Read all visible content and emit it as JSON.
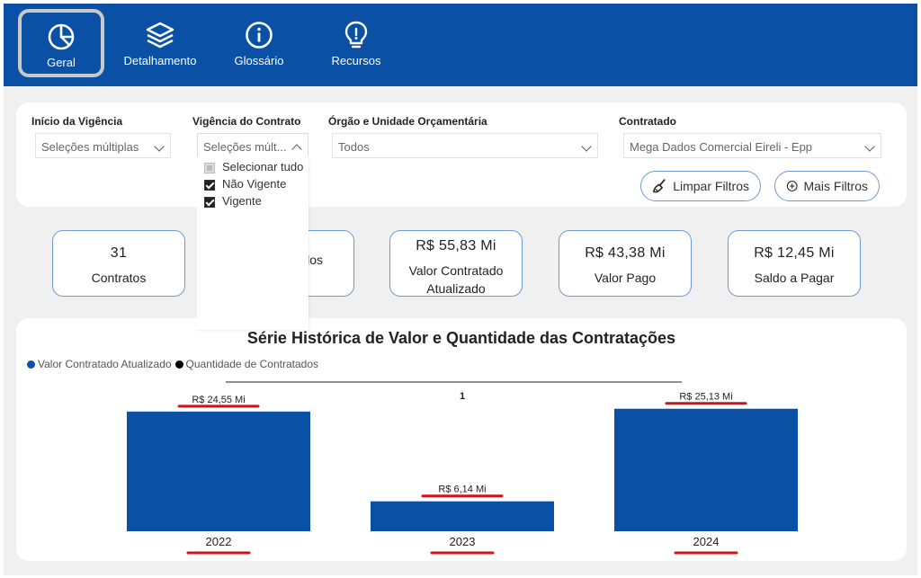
{
  "nav": {
    "items": [
      {
        "label": "Geral",
        "icon": "pie-chart-icon",
        "active": true
      },
      {
        "label": "Detalhamento",
        "icon": "layers-icon",
        "active": false
      },
      {
        "label": "Glossário",
        "icon": "info-icon",
        "active": false
      },
      {
        "label": "Recursos",
        "icon": "lightbulb-icon",
        "active": false
      }
    ]
  },
  "filters": {
    "inicio": {
      "label": "Início da Vigência",
      "value": "Seleções múltiplas"
    },
    "vigencia": {
      "label": "Vigência do Contrato",
      "value": "Seleções múlt...",
      "options": [
        {
          "label": "Selecionar tudo",
          "state": "partial"
        },
        {
          "label": "Não Vigente",
          "state": "checked"
        },
        {
          "label": "Vigente",
          "state": "checked"
        }
      ]
    },
    "orgao": {
      "label": "Órgão e Unidade Orçamentária",
      "value": "Todos"
    },
    "contratado": {
      "label": "Contratado",
      "value": "Mega Dados Comercial Eireli - Epp"
    },
    "clear_button": "Limpar Filtros",
    "more_button": "Mais Filtros"
  },
  "kpis": [
    {
      "value": "31",
      "label": "Contratos"
    },
    {
      "value": "",
      "label": "los"
    },
    {
      "value": "R$ 55,83 Mi",
      "label_line1": "Valor Contratado",
      "label_line2": "Atualizado"
    },
    {
      "value": "R$ 43,38 Mi",
      "label": "Valor Pago"
    },
    {
      "value": "R$ 12,45 Mi",
      "label": "Saldo a Pagar"
    }
  ],
  "colors": {
    "primary": "#0a51a5",
    "highlight": "#d0121b",
    "card_border": "#6e9ad0"
  },
  "chart_data": {
    "type": "bar",
    "title": "Série Histórica de Valor e Quantidade das Contratações",
    "legend": [
      "Valor Contratado Atualizado",
      "Quantidade de Contratados"
    ],
    "legend_colors": [
      "#0a51a5",
      "#000000"
    ],
    "categories": [
      "2022",
      "2023",
      "2024"
    ],
    "series": [
      {
        "name": "Valor Contratado Atualizado",
        "values": [
          24.55,
          6.14,
          25.13
        ],
        "labels": [
          "R$ 24,55 Mi",
          "R$ 6,14 Mi",
          "R$ 25,13 Mi"
        ]
      },
      {
        "name": "Quantidade de Contratados",
        "values": [
          null,
          1,
          null
        ],
        "labels": [
          "",
          "1",
          ""
        ]
      }
    ],
    "ylim": [
      0,
      26
    ]
  }
}
